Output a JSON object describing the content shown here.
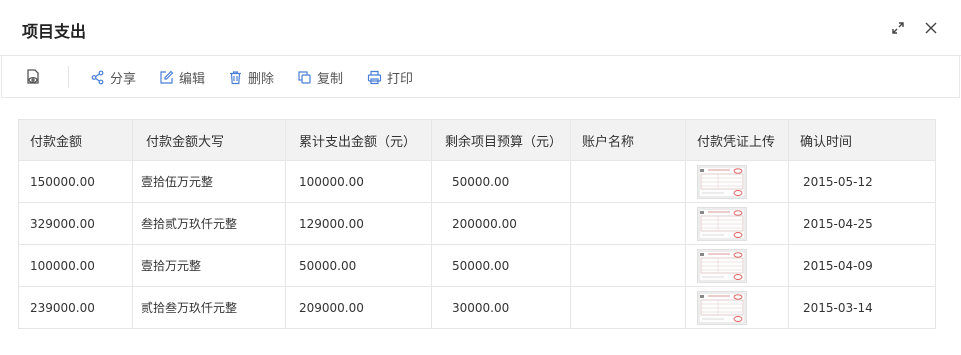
{
  "dialog": {
    "title": "项目支出"
  },
  "toolbar": {
    "items": [
      {
        "label": "分享",
        "icon": "share-icon"
      },
      {
        "label": "编辑",
        "icon": "edit-icon"
      },
      {
        "label": "删除",
        "icon": "trash-icon"
      },
      {
        "label": "复制",
        "icon": "copy-icon"
      },
      {
        "label": "打印",
        "icon": "printer-icon"
      }
    ]
  },
  "table": {
    "columns": [
      "付款金额",
      "付款金额大写",
      "累计支出金额（元）",
      "剩余项目预算（元）",
      "账户名称",
      "付款凭证上传",
      "确认时间"
    ],
    "rows": [
      {
        "amount": "150000.00",
        "amount_upper": "壹拾伍万元整",
        "cumulative": "100000.00",
        "remaining": "50000.00",
        "account": "",
        "date": "2015-05-12"
      },
      {
        "amount": "329000.00",
        "amount_upper": "叁拾贰万玖仟元整",
        "cumulative": "129000.00",
        "remaining": "200000.00",
        "account": "",
        "date": "2015-04-25"
      },
      {
        "amount": "100000.00",
        "amount_upper": "壹拾万元整",
        "cumulative": "50000.00",
        "remaining": "50000.00",
        "account": "",
        "date": "2015-04-09"
      },
      {
        "amount": "239000.00",
        "amount_upper": "贰拾叁万玖仟元整",
        "cumulative": "209000.00",
        "remaining": "30000.00",
        "account": "",
        "date": "2015-03-14"
      }
    ]
  },
  "colors": {
    "accent": "#4a7fd6",
    "header_bg": "#f2f2f2",
    "border": "#e6e6e6",
    "stamp": "#e05a5a"
  }
}
